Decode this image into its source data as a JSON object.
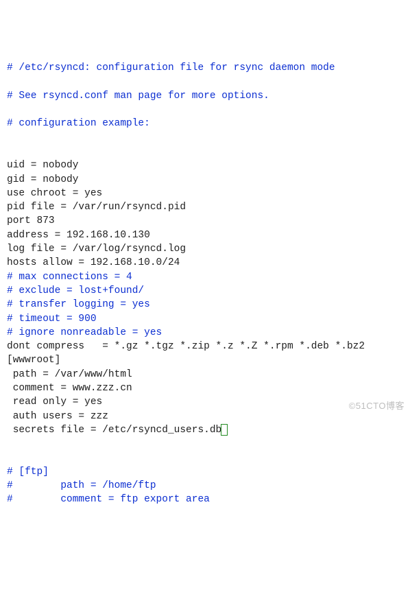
{
  "file": {
    "lines": [
      {
        "cls": "comment",
        "text": "# /etc/rsyncd: configuration file for rsync daemon mode"
      },
      {
        "cls": "blank",
        "text": ""
      },
      {
        "cls": "comment",
        "text": "# See rsyncd.conf man page for more options."
      },
      {
        "cls": "blank",
        "text": ""
      },
      {
        "cls": "comment",
        "text": "# configuration example:"
      },
      {
        "cls": "blank",
        "text": ""
      },
      {
        "cls": "blank",
        "text": ""
      },
      {
        "cls": "plain",
        "text": "uid = nobody"
      },
      {
        "cls": "plain",
        "text": "gid = nobody"
      },
      {
        "cls": "plain",
        "text": "use chroot = yes"
      },
      {
        "cls": "plain",
        "text": "pid file = /var/run/rsyncd.pid"
      },
      {
        "cls": "plain",
        "text": "port 873"
      },
      {
        "cls": "plain",
        "text": "address = 192.168.10.130"
      },
      {
        "cls": "plain",
        "text": "log file = /var/log/rsyncd.log"
      },
      {
        "cls": "plain",
        "text": "hosts allow = 192.168.10.0/24"
      },
      {
        "cls": "comment",
        "text": "# max connections = 4"
      },
      {
        "cls": "comment",
        "text": "# exclude = lost+found/"
      },
      {
        "cls": "comment",
        "text": "# transfer logging = yes"
      },
      {
        "cls": "comment",
        "text": "# timeout = 900"
      },
      {
        "cls": "comment",
        "text": "# ignore nonreadable = yes"
      },
      {
        "cls": "plain",
        "text": "dont compress   = *.gz *.tgz *.zip *.z *.Z *.rpm *.deb *.bz2"
      },
      {
        "cls": "plain",
        "text": "[wwwroot]"
      },
      {
        "cls": "plain",
        "text": " path = /var/www/html"
      },
      {
        "cls": "plain",
        "text": " comment = www.zzz.cn"
      },
      {
        "cls": "plain",
        "text": " read only = yes"
      },
      {
        "cls": "plain",
        "text": " auth users = zzz"
      },
      {
        "cls": "plain",
        "text": " secrets file = /etc/rsyncd_users.db",
        "cursor": true
      },
      {
        "cls": "blank",
        "text": ""
      },
      {
        "cls": "blank",
        "text": ""
      },
      {
        "cls": "comment",
        "text": "# [ftp]"
      },
      {
        "cls": "comment",
        "text": "#        path = /home/ftp"
      },
      {
        "cls": "comment",
        "text": "#        comment = ftp export area"
      }
    ]
  },
  "watermark": "©51CTO博客"
}
